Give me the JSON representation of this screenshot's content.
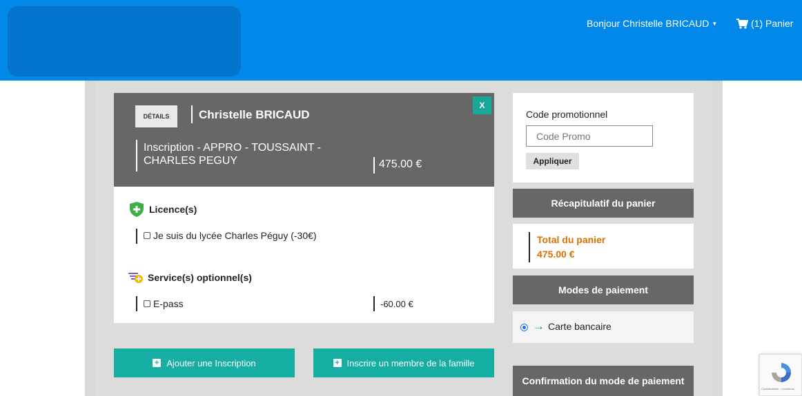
{
  "header": {
    "greeting": "Bonjour Christelle BRICAUD",
    "cart_label": "(1) Panier"
  },
  "registration": {
    "details_label": "DÉTAILS",
    "person_name": "Christelle BRICAUD",
    "close_label": "X",
    "title": "Inscription - APPRO - TOUSSAINT - CHARLES PEGUY",
    "price": "475.00 €"
  },
  "licences": {
    "title": "Licence(s)",
    "items": [
      {
        "label": "Je suis du lycée Charles Péguy (-30€)",
        "checked": false
      }
    ]
  },
  "services": {
    "title": "Service(s) optionnel(s)",
    "items": [
      {
        "label": "E-pass",
        "price": "-60.00 €",
        "checked": false
      }
    ]
  },
  "actions": {
    "add_registration": "Ajouter une Inscription",
    "add_family_member": "Inscrire un membre de la famille"
  },
  "promo": {
    "label": "Code promotionnel",
    "placeholder": "Code Promo",
    "apply": "Appliquer"
  },
  "summary": {
    "title": "Récapitulatif du panier",
    "total_label": "Total du panier",
    "total_value": "475.00 €"
  },
  "payment": {
    "title": "Modes de paiement",
    "method": "Carte bancaire",
    "confirm_title": "Confirmation du mode de paiement"
  },
  "recaptcha": {
    "text": "Confidentialité - Conditions"
  },
  "colors": {
    "header_blue": "#0288e8",
    "teal": "#16aea3",
    "dark_gray": "#676767",
    "orange": "#d97000"
  }
}
